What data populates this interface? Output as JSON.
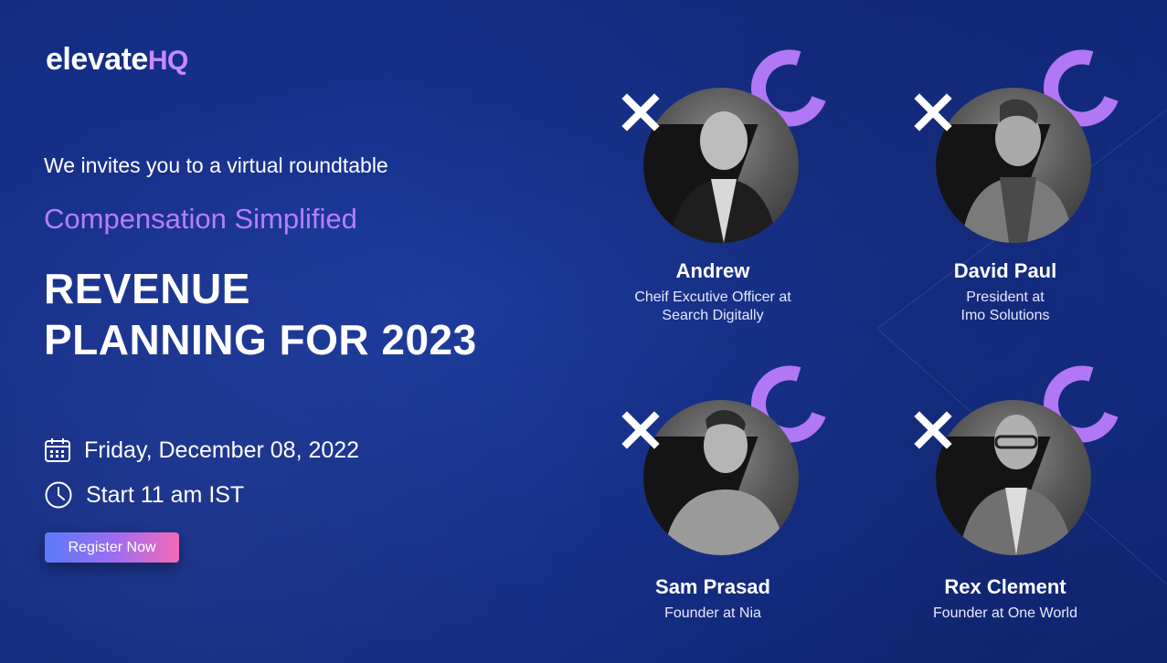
{
  "logo": {
    "main": "elevate",
    "suffix": "HQ"
  },
  "invite_text": "We invites you to a virtual roundtable",
  "subtitle": "Compensation Simplified",
  "headline": {
    "line1": "REVENUE",
    "line2": "PLANNING FOR 2023"
  },
  "event": {
    "date": "Friday, December 08, 2022",
    "time": "Start 11 am IST"
  },
  "cta": {
    "label": "Register Now"
  },
  "speakers": [
    {
      "name": "Andrew",
      "role_line1": "Cheif Excutive Officer at",
      "role_line2": "Search Digitally"
    },
    {
      "name": "David Paul",
      "role_line1": "President at",
      "role_line2": "Imo Solutions"
    },
    {
      "name": "Sam Prasad",
      "role_line1": "Founder at Nia",
      "role_line2": ""
    },
    {
      "name": "Rex Clement",
      "role_line1": "Founder  at One World",
      "role_line2": ""
    }
  ],
  "colors": {
    "background": "#16308a",
    "accent_purple": "#b77dff",
    "x_mark": "#ffffff"
  },
  "icons": [
    "calendar-icon",
    "clock-icon",
    "x-mark-icon",
    "c-arc-icon"
  ]
}
